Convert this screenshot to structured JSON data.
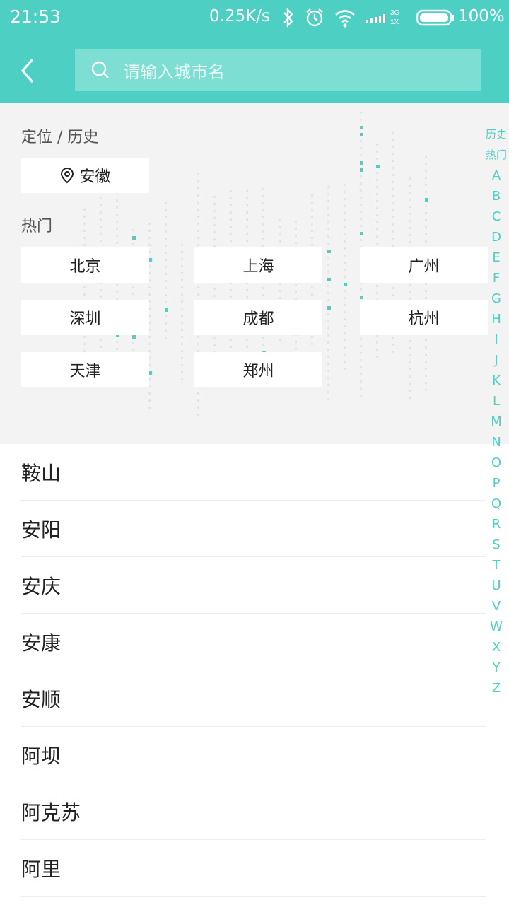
{
  "status_bar": {
    "time": "21:53",
    "net_speed": "0.25K/s",
    "signal_label": "3G 1X",
    "battery": "100%",
    "icons": [
      "bluetooth-icon",
      "alarm-icon",
      "wifi-icon",
      "signal-icon",
      "battery-icon"
    ]
  },
  "header": {
    "back_icon": "back-icon",
    "search_placeholder": "请输入城市名"
  },
  "location_section": {
    "title": "定位 / 历史",
    "current_city": "安徽"
  },
  "hot_section": {
    "title": "热门",
    "cities": [
      "北京",
      "上海",
      "广州",
      "深圳",
      "成都",
      "杭州",
      "天津",
      "郑州"
    ]
  },
  "index_bar": [
    "历史",
    "热门",
    "A",
    "B",
    "C",
    "D",
    "E",
    "F",
    "G",
    "H",
    "I",
    "J",
    "K",
    "L",
    "M",
    "N",
    "O",
    "P",
    "Q",
    "R",
    "S",
    "T",
    "U",
    "V",
    "W",
    "X",
    "Y",
    "Z"
  ],
  "city_list": [
    "鞍山",
    "安阳",
    "安庆",
    "安康",
    "安顺",
    "阿坝",
    "阿克苏",
    "阿里"
  ],
  "colors": {
    "accent": "#4ecfc3",
    "search_bg": "#7ddfd4",
    "panel_bg": "#f3f3f3"
  }
}
